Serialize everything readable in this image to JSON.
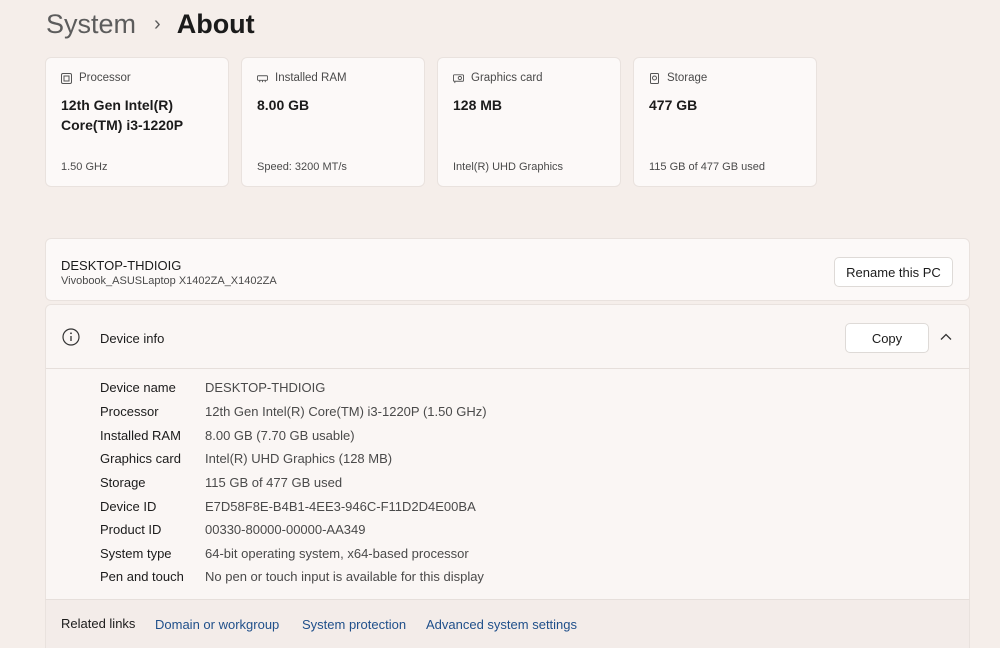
{
  "breadcrumb": {
    "parent": "System",
    "separator": "›",
    "current": "About"
  },
  "spec_cards": [
    {
      "icon": "processor-icon",
      "label": "Processor",
      "value": "12th Gen Intel(R) Core(TM) i3-1220P",
      "sub": "1.50 GHz"
    },
    {
      "icon": "ram-icon",
      "label": "Installed RAM",
      "value": "8.00 GB",
      "sub": "Speed: 3200 MT/s"
    },
    {
      "icon": "graphics-card-icon",
      "label": "Graphics card",
      "value": "128 MB",
      "sub": "Intel(R) UHD Graphics"
    },
    {
      "icon": "storage-icon",
      "label": "Storage",
      "value": "477 GB",
      "sub": "115 GB of 477 GB used"
    }
  ],
  "pc": {
    "name": "DESKTOP-THDIOIG",
    "model": "Vivobook_ASUSLaptop X1402ZA_X1402ZA",
    "rename_label": "Rename this PC"
  },
  "device_info": {
    "title": "Device info",
    "copy_label": "Copy",
    "rows": [
      {
        "key": "Device name",
        "value": "DESKTOP-THDIOIG"
      },
      {
        "key": "Processor",
        "value": "12th Gen Intel(R) Core(TM) i3-1220P (1.50 GHz)"
      },
      {
        "key": "Installed RAM",
        "value": "8.00 GB (7.70 GB usable)"
      },
      {
        "key": "Graphics card",
        "value": "Intel(R) UHD Graphics (128 MB)"
      },
      {
        "key": "Storage",
        "value": "115 GB of 477 GB used"
      },
      {
        "key": "Device ID",
        "value": "E7D58F8E-B4B1-4EE3-946C-F11D2D4E00BA"
      },
      {
        "key": "Product ID",
        "value": "00330-80000-00000-AA349"
      },
      {
        "key": "System type",
        "value": "64-bit operating system, x64-based processor"
      },
      {
        "key": "Pen and touch",
        "value": "No pen or touch input is available for this display"
      }
    ]
  },
  "related_links": {
    "label": "Related links",
    "links": [
      "Domain or workgroup",
      "System protection",
      "Advanced system settings"
    ]
  },
  "colors": {
    "background": "#f5eeea",
    "card": "#fcf9f8",
    "link": "#1f4f8a"
  }
}
